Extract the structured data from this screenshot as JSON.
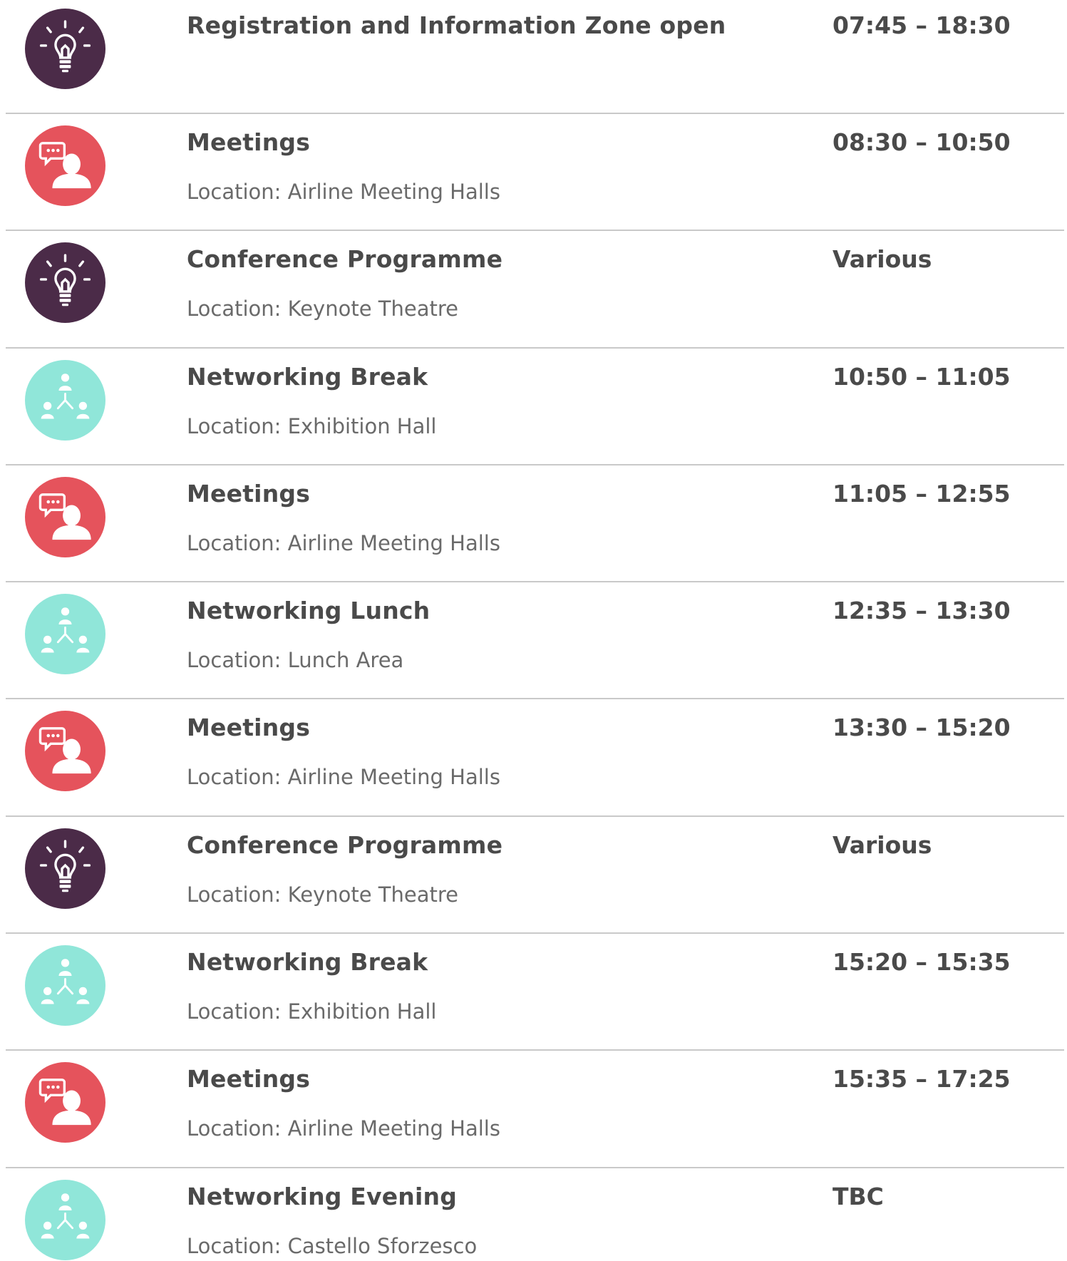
{
  "colors": {
    "ideas": "#4b2b48",
    "meetings": "#e5535c",
    "networking": "#90e6d9",
    "title_text": "#4a4a4a",
    "location_text": "#6a6a6a",
    "divider": "#c9c9c9"
  },
  "schedule": [
    {
      "icon": "lightbulb-icon",
      "category": "ideas",
      "title": "Registration and Information Zone open",
      "location": "",
      "time": "07:45 – 18:30"
    },
    {
      "icon": "meeting-chat-icon",
      "category": "meetings",
      "title": "Meetings",
      "location": "Location: Airline Meeting Halls",
      "time": "08:30 – 10:50"
    },
    {
      "icon": "lightbulb-icon",
      "category": "ideas",
      "title": "Conference Programme",
      "location": "Location: Keynote Theatre",
      "time": "Various"
    },
    {
      "icon": "network-people-icon",
      "category": "networking",
      "title": "Networking Break",
      "location": "Location: Exhibition Hall",
      "time": "10:50 – 11:05"
    },
    {
      "icon": "meeting-chat-icon",
      "category": "meetings",
      "title": "Meetings",
      "location": "Location: Airline Meeting Halls",
      "time": "11:05 – 12:55"
    },
    {
      "icon": "network-people-icon",
      "category": "networking",
      "title": "Networking Lunch",
      "location": "Location: Lunch Area",
      "time": "12:35 – 13:30"
    },
    {
      "icon": "meeting-chat-icon",
      "category": "meetings",
      "title": "Meetings",
      "location": "Location: Airline Meeting Halls",
      "time": "13:30 – 15:20"
    },
    {
      "icon": "lightbulb-icon",
      "category": "ideas",
      "title": "Conference Programme",
      "location": "Location: Keynote Theatre",
      "time": "Various"
    },
    {
      "icon": "network-people-icon",
      "category": "networking",
      "title": "Networking Break",
      "location": "Location: Exhibition Hall",
      "time": "15:20 – 15:35"
    },
    {
      "icon": "meeting-chat-icon",
      "category": "meetings",
      "title": "Meetings",
      "location": "Location: Airline Meeting Halls",
      "time": "15:35 – 17:25"
    },
    {
      "icon": "network-people-icon",
      "category": "networking",
      "title": "Networking Evening",
      "location": "Location: Castello Sforzesco",
      "time": "TBC"
    }
  ]
}
